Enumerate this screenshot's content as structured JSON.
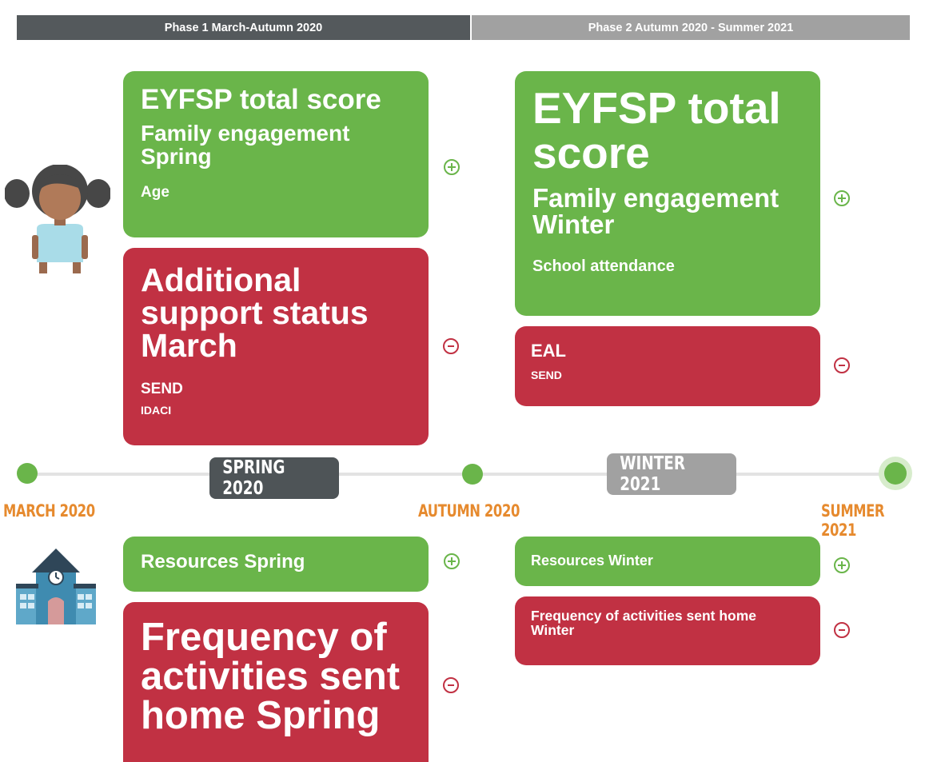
{
  "phases": [
    {
      "label": "Phase 1 March-Autumn 2020",
      "color": "#54595c"
    },
    {
      "label": "Phase 2 Autumn 2020 - Summer 2021",
      "color": "#a1a1a1"
    }
  ],
  "timeline": {
    "dates": [
      "MARCH 2020",
      "AUTUMN 2020",
      "SUMMER 2021"
    ],
    "seasons": [
      "SPRING 2020",
      "WINTER 2021"
    ]
  },
  "icons": {
    "child": "girl-icon",
    "school": "school-building-icon",
    "plus": "plus-circle-icon",
    "minus": "minus-circle-icon"
  },
  "colors": {
    "positive": "#6ab54a",
    "negative": "#c13143",
    "date": "#e68a2e"
  },
  "child": {
    "phase1": {
      "positive": [
        "EYFSP total score",
        "Family engagement Spring",
        "Age"
      ],
      "negative": [
        "Additional support status March",
        "SEND",
        "IDACI"
      ]
    },
    "phase2": {
      "positive": [
        "EYFSP total score",
        "Family engagement Winter",
        "School attendance"
      ],
      "negative": [
        "EAL",
        "SEND"
      ]
    }
  },
  "school": {
    "phase1": {
      "positive": [
        "Resources Spring"
      ],
      "negative": [
        "Frequency of activities sent home Spring"
      ]
    },
    "phase2": {
      "positive": [
        "Resources Winter"
      ],
      "negative": [
        "Frequency of activities sent home Winter"
      ]
    }
  }
}
